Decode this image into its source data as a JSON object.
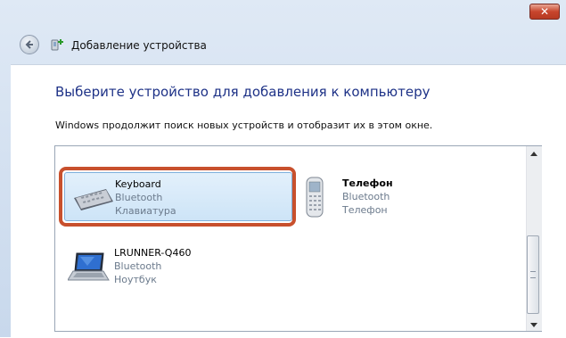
{
  "window": {
    "title": "Добавление устройства",
    "close_label": "✕"
  },
  "page": {
    "heading": "Выберите устройство для добавления к компьютеру",
    "info": "Windows продолжит поиск новых устройств и отобразит их в этом окне."
  },
  "devices": [
    {
      "name": "Keyboard",
      "connection": "Bluetooth",
      "type": "Клавиатура",
      "icon": "keyboard-icon",
      "selected": true
    },
    {
      "name": "Телефон",
      "connection": "Bluetooth",
      "type": "Телефон",
      "icon": "phone-icon",
      "selected": false
    },
    {
      "name": "LRUNNER-Q460",
      "connection": "Bluetooth",
      "type": "Ноутбук",
      "icon": "laptop-icon",
      "selected": false
    }
  ],
  "colors": {
    "heading": "#1e3287",
    "highlight": "#c8502d",
    "selection": "#cde4f7"
  }
}
